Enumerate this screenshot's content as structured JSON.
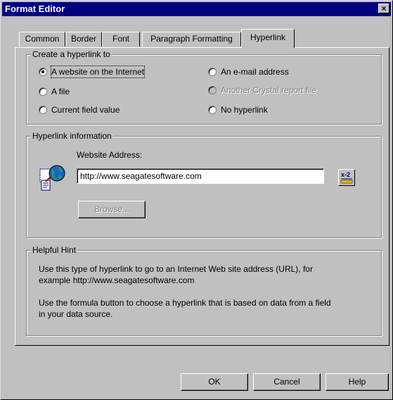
{
  "window": {
    "title": "Format Editor",
    "close_glyph": "×"
  },
  "tabs": [
    {
      "label": "Common"
    },
    {
      "label": "Border"
    },
    {
      "label": "Font"
    },
    {
      "label": "Paragraph Formatting"
    },
    {
      "label": "Hyperlink"
    }
  ],
  "create_group": {
    "legend": "Create a hyperlink to",
    "options": [
      {
        "label": "A website on the Internet",
        "checked": true,
        "enabled": true
      },
      {
        "label": "A file",
        "checked": false,
        "enabled": true
      },
      {
        "label": "Current field value",
        "checked": false,
        "enabled": true
      },
      {
        "label": "An e-mail address",
        "checked": false,
        "enabled": true
      },
      {
        "label": "Another Crystal report file",
        "checked": false,
        "enabled": false
      },
      {
        "label": "No hyperlink",
        "checked": false,
        "enabled": true
      }
    ]
  },
  "info_group": {
    "legend": "Hyperlink information",
    "address_label": "Website Address:",
    "address_value": "http://www.seagatesoftware.com",
    "browse_label": "Browse...",
    "formula_icon": "formula-x2-icon",
    "globe_icon": "hyperlink-globe-icon"
  },
  "hint_group": {
    "legend": "Helpful Hint",
    "line1": "Use this type of hyperlink to go to an Internet Web site address (URL), for",
    "line2": "example http://www.seagatesoftware.com",
    "line3": "Use the formula button to choose a hyperlink that is based on data from a field",
    "line4": "in your data source."
  },
  "buttons": {
    "ok": "OK",
    "cancel": "Cancel",
    "help": "Help"
  },
  "colors": {
    "titlebar": "#000080",
    "face": "#c0c0c0",
    "disabled_text": "#808080"
  }
}
